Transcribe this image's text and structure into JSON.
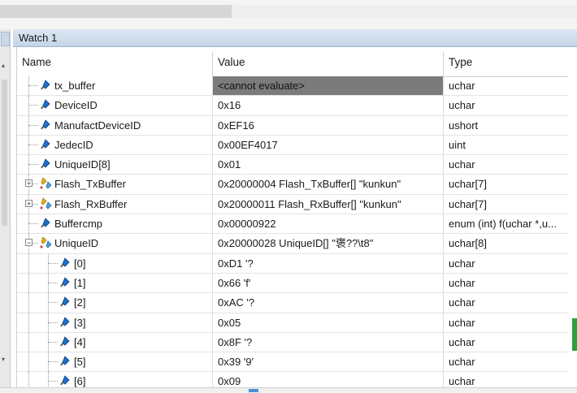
{
  "window": {
    "title": "Watch 1"
  },
  "columns": {
    "name": "Name",
    "value": "Value",
    "type": "Type"
  },
  "rows": [
    {
      "name": "tx_buffer",
      "value": "<cannot evaluate>",
      "type": "uchar",
      "kind": "var",
      "level": 0,
      "selected": true
    },
    {
      "name": "DeviceID",
      "value": "0x16",
      "type": "uchar",
      "kind": "var",
      "level": 0
    },
    {
      "name": "ManufactDeviceID",
      "value": "0xEF16",
      "type": "ushort",
      "kind": "var",
      "level": 0
    },
    {
      "name": "JedecID",
      "value": "0x00EF4017",
      "type": "uint",
      "kind": "var",
      "level": 0
    },
    {
      "name": "UniqueID[8]",
      "value": "0x01",
      "type": "uchar",
      "kind": "var",
      "level": 0
    },
    {
      "name": "Flash_TxBuffer",
      "value": "0x20000004 Flash_TxBuffer[] \"kunkun\"",
      "type": "uchar[7]",
      "kind": "struct",
      "level": 0,
      "expander": "+"
    },
    {
      "name": "Flash_RxBuffer",
      "value": "0x20000011 Flash_RxBuffer[] \"kunkun\"",
      "type": "uchar[7]",
      "kind": "struct",
      "level": 0,
      "expander": "+"
    },
    {
      "name": "Buffercmp",
      "value": "0x00000922",
      "type": "enum (int) f(uchar *,u...",
      "kind": "var",
      "level": 0
    },
    {
      "name": "UniqueID",
      "value": "0x20000028 UniqueID[] \"褒??\\t8\"",
      "type": "uchar[8]",
      "kind": "struct",
      "level": 0,
      "expander": "−"
    },
    {
      "name": "[0]",
      "value": "0xD1 '?",
      "type": "uchar",
      "kind": "var",
      "level": 1
    },
    {
      "name": "[1]",
      "value": "0x66 'f'",
      "type": "uchar",
      "kind": "var",
      "level": 1
    },
    {
      "name": "[2]",
      "value": "0xAC '?",
      "type": "uchar",
      "kind": "var",
      "level": 1
    },
    {
      "name": "[3]",
      "value": "0x05",
      "type": "uchar",
      "kind": "var",
      "level": 1
    },
    {
      "name": "[4]",
      "value": "0x8F '?",
      "type": "uchar",
      "kind": "var",
      "level": 1
    },
    {
      "name": "[5]",
      "value": "0x39 '9'",
      "type": "uchar",
      "kind": "var",
      "level": 1
    },
    {
      "name": "[6]",
      "value": "0x09",
      "type": "uchar",
      "kind": "var",
      "level": 1
    }
  ],
  "icons": {
    "var": "watch-variable-icon",
    "struct": "struct-variable-icon"
  },
  "colors": {
    "selection": "#7b7b7b",
    "titlebar": "#c6d5e7",
    "diamond": "#1f6fc9"
  }
}
